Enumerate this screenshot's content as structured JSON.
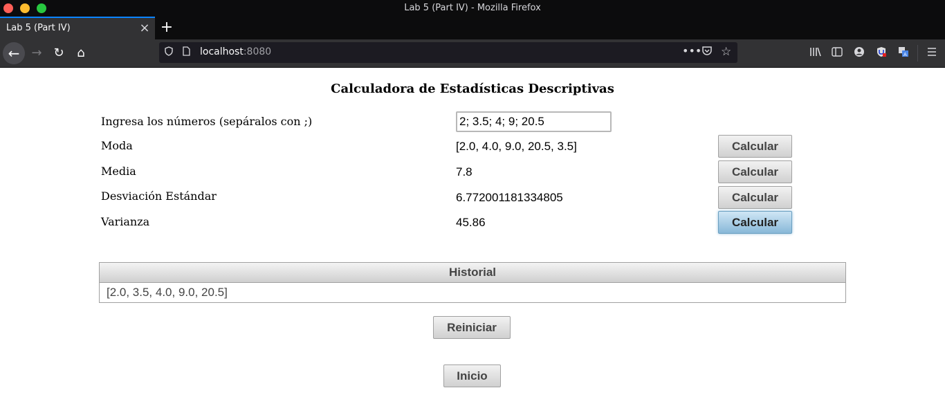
{
  "window": {
    "title": "Lab 5 (Part IV) - Mozilla Firefox"
  },
  "tab": {
    "label": "Lab 5 (Part IV)",
    "close": "×",
    "new_tab": "+"
  },
  "navbar": {
    "back": "←",
    "forward": "→",
    "reload": "↻",
    "home": "⌂",
    "url_host": "localhost",
    "url_port": ":8080",
    "more": "•••",
    "icons": [
      "shield-icon",
      "page-icon",
      "pocket-icon",
      "bookmark-star-icon",
      "library-icon",
      "sidebar-icon",
      "account-icon",
      "ublock-icon",
      "translate-icon",
      "menu-icon"
    ]
  },
  "page": {
    "title": "Calculadora de Estadísticas Descriptivas",
    "input": {
      "label": "Ingresa los números (sepáralos con ;)",
      "value": "2; 3.5; 4; 9; 20.5"
    },
    "rows": [
      {
        "label": "Moda",
        "value": "[2.0, 4.0, 9.0, 20.5, 3.5]",
        "button": "Calcular"
      },
      {
        "label": "Media",
        "value": "7.8",
        "button": "Calcular"
      },
      {
        "label": "Desviación Estándar",
        "value": "6.772001181334805",
        "button": "Calcular"
      },
      {
        "label": "Varianza",
        "value": "45.86",
        "button": "Calcular"
      }
    ],
    "history": {
      "header": "Historial",
      "entries": [
        "[2.0, 3.5, 4.0, 9.0, 20.5]"
      ]
    },
    "reset_button": "Reiniciar",
    "home_button": "Inicio"
  },
  "colors": {
    "chrome_dark": "#0c0c0d",
    "toolbar": "#323234",
    "tab_accent": "#0a84ff",
    "active_button": "#88b8d8"
  }
}
